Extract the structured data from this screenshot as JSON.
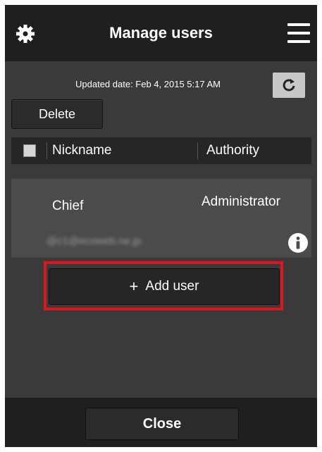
{
  "header": {
    "title": "Manage users",
    "settings_icon": "gear-icon",
    "menu_icon": "hamburger-menu-icon"
  },
  "updated": {
    "text": "Updated date: Feb 4, 2015 5:17 AM",
    "refresh_icon": "refresh-icon"
  },
  "toolbar": {
    "delete_label": "Delete"
  },
  "table": {
    "headers": [
      "Nickname",
      "Authority"
    ],
    "rows": [
      {
        "nickname": "Chief",
        "authority": "Administrator",
        "email": "@c1@ecoweb.ne.jp"
      }
    ]
  },
  "add_user": {
    "label": "Add user"
  },
  "footer": {
    "close_label": "Close"
  },
  "colors": {
    "background": "#3a3a3a",
    "header": "#1f1f1f",
    "highlight": "#e0141f"
  }
}
